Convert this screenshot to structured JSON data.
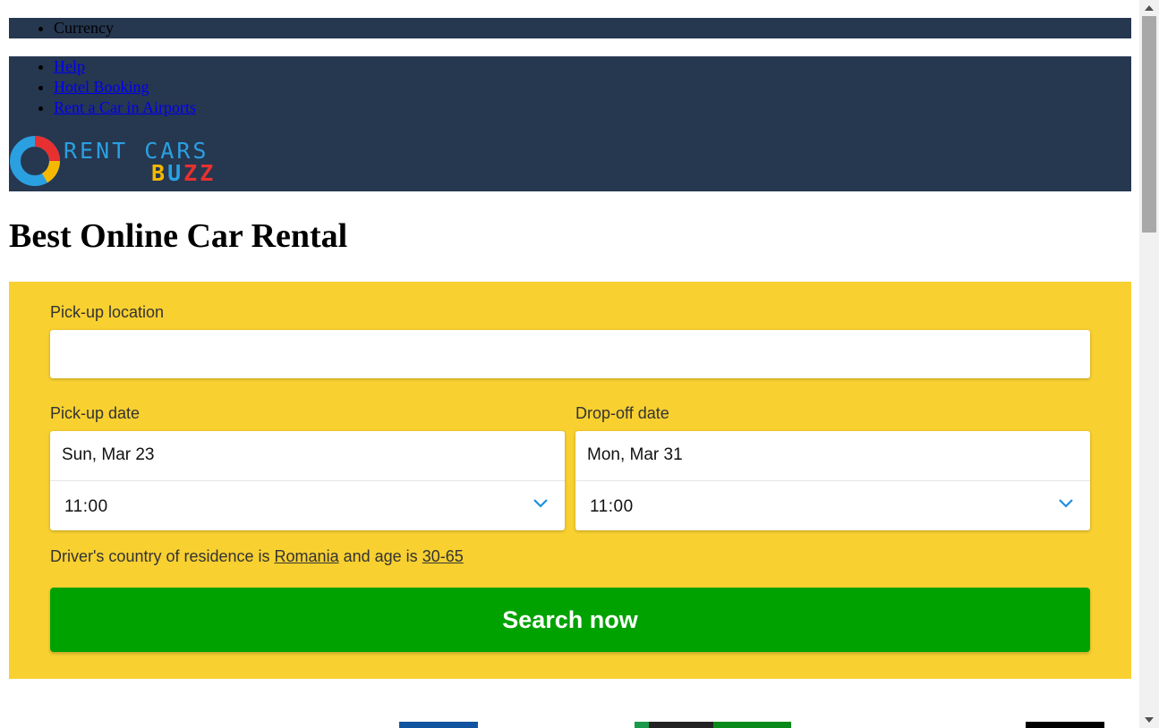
{
  "top_nav": {
    "currency_label": "Currency",
    "links": [
      "Help",
      "Hotel Booking",
      "Rent a Car in Airports"
    ]
  },
  "logo": {
    "line1": "RENT CARS",
    "line2_letters": [
      "B",
      "U",
      "Z",
      "Z"
    ]
  },
  "page_title": "Best Online Car Rental",
  "search_form": {
    "pickup_location_label": "Pick-up location",
    "pickup_location_value": "",
    "pickup_date_label": "Pick-up date",
    "pickup_date_value": "Sun, Mar 23",
    "pickup_time_value": "11:00",
    "dropoff_date_label": "Drop-off date",
    "dropoff_date_value": "Mon, Mar 31",
    "dropoff_time_value": "11:00",
    "residence_prefix": "Driver's country of residence is",
    "residence_country": "Romania",
    "residence_age_prefix": "and age is",
    "residence_age": "30-65",
    "search_button_label": "Search now"
  },
  "colors": {
    "header_bg": "#263750",
    "panel_bg": "#f8d030",
    "button_bg": "#00a200",
    "logo_blue": "#2aa0e0",
    "logo_yellow": "#f5b800",
    "logo_red": "#e83030"
  }
}
